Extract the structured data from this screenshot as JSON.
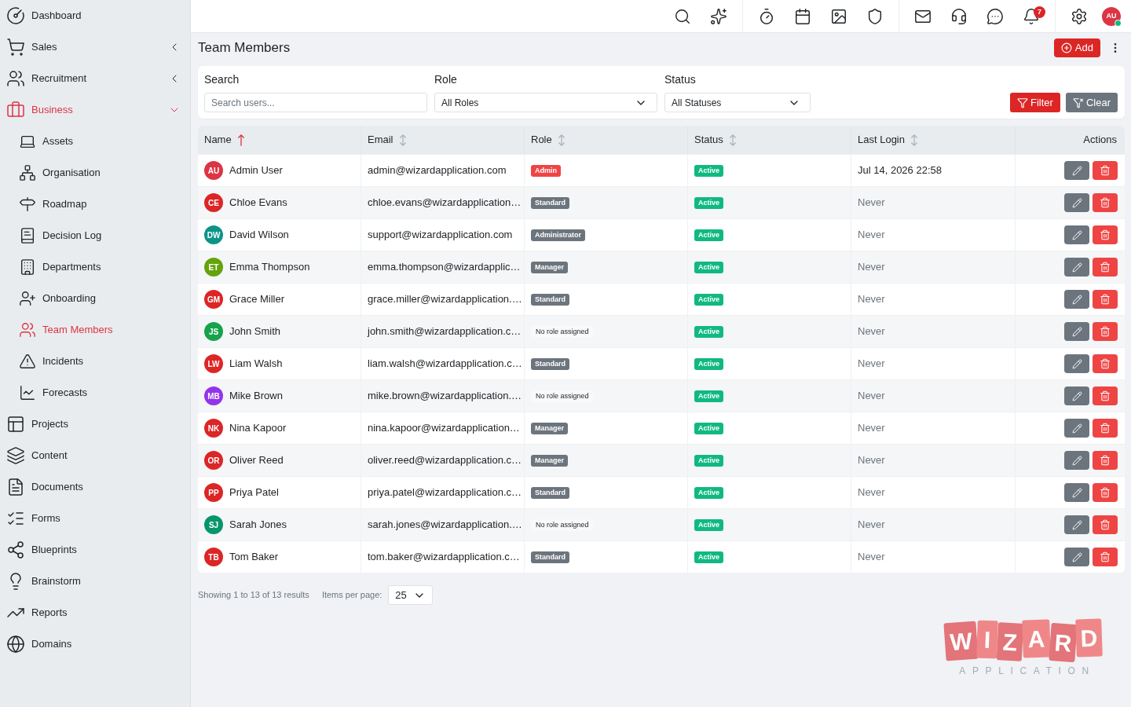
{
  "sidebar": {
    "items": [
      {
        "label": "Dashboard",
        "selected": false
      },
      {
        "label": "Sales",
        "selected": false,
        "expanded": false
      },
      {
        "label": "Recruitment",
        "selected": false,
        "expanded": false
      },
      {
        "label": "Business",
        "selected": true,
        "expanded": true,
        "children": [
          {
            "label": "Assets",
            "selected": false
          },
          {
            "label": "Organisation",
            "selected": false
          },
          {
            "label": "Roadmap",
            "selected": false
          },
          {
            "label": "Decision Log",
            "selected": false
          },
          {
            "label": "Departments",
            "selected": false
          },
          {
            "label": "Onboarding",
            "selected": false
          },
          {
            "label": "Team Members",
            "selected": true
          },
          {
            "label": "Incidents",
            "selected": false
          },
          {
            "label": "Forecasts",
            "selected": false
          }
        ]
      },
      {
        "label": "Projects",
        "selected": false
      },
      {
        "label": "Content",
        "selected": false
      },
      {
        "label": "Documents",
        "selected": false
      },
      {
        "label": "Forms",
        "selected": false
      },
      {
        "label": "Blueprints",
        "selected": false
      },
      {
        "label": "Brainstorm",
        "selected": false
      },
      {
        "label": "Reports",
        "selected": false
      },
      {
        "label": "Domains",
        "selected": false
      }
    ]
  },
  "topbar": {
    "notification_count": "7",
    "user": {
      "initials": "AU",
      "online": true
    }
  },
  "page": {
    "title": "Team Members",
    "add_button": "Add"
  },
  "filters": {
    "search": {
      "label": "Search",
      "placeholder": "Search users..."
    },
    "role": {
      "label": "Role",
      "value": "All Roles"
    },
    "status": {
      "label": "Status",
      "value": "All Statuses"
    },
    "buttons": [
      {
        "label": "Filter",
        "kind": "primary"
      },
      {
        "label": "Clear",
        "kind": "secondary"
      }
    ]
  },
  "table": {
    "columns": [
      {
        "label": "Name",
        "sorted": true
      },
      {
        "label": "Email",
        "sorted": false
      },
      {
        "label": "Role",
        "sorted": false
      },
      {
        "label": "Status",
        "sorted": false
      },
      {
        "label": "Last Login",
        "sorted": false
      },
      {
        "label": "Actions"
      }
    ],
    "rows": [
      {
        "initials": "AU",
        "color": "#dc3545",
        "name": "Admin User",
        "email": "admin@wizardapplication.com",
        "role": {
          "label": "Admin",
          "kind": "admin"
        },
        "status": "Active",
        "last_login": {
          "text": "Jul 14, 2026 22:58",
          "muted": false
        }
      },
      {
        "initials": "CE",
        "color": "#dc2626",
        "name": "Chloe Evans",
        "email": "chloe.evans@wizardapplication…",
        "role": {
          "label": "Standard",
          "kind": "assigned"
        },
        "status": "Active",
        "last_login": {
          "text": "Never",
          "muted": true
        }
      },
      {
        "initials": "DW",
        "color": "#0d9488",
        "name": "David Wilson",
        "email": "support@wizardapplication.com",
        "role": {
          "label": "Administrator",
          "kind": "assigned"
        },
        "status": "Active",
        "last_login": {
          "text": "Never",
          "muted": true
        }
      },
      {
        "initials": "ET",
        "color": "#65a30d",
        "name": "Emma Thompson",
        "email": "emma.thompson@wizardapplic…",
        "role": {
          "label": "Manager",
          "kind": "assigned"
        },
        "status": "Active",
        "last_login": {
          "text": "Never",
          "muted": true
        }
      },
      {
        "initials": "GM",
        "color": "#dc2626",
        "name": "Grace Miller",
        "email": "grace.miller@wizardapplication.…",
        "role": {
          "label": "Standard",
          "kind": "assigned"
        },
        "status": "Active",
        "last_login": {
          "text": "Never",
          "muted": true
        }
      },
      {
        "initials": "JS",
        "color": "#16a34a",
        "name": "John Smith",
        "email": "john.smith@wizardapplication.c…",
        "role": {
          "label": "No role assigned",
          "kind": "unassigned"
        },
        "status": "Active",
        "last_login": {
          "text": "Never",
          "muted": true
        }
      },
      {
        "initials": "LW",
        "color": "#dc2626",
        "name": "Liam Walsh",
        "email": "liam.walsh@wizardapplication.c…",
        "role": {
          "label": "Standard",
          "kind": "assigned"
        },
        "status": "Active",
        "last_login": {
          "text": "Never",
          "muted": true
        }
      },
      {
        "initials": "MB",
        "color": "#9333ea",
        "name": "Mike Brown",
        "email": "mike.brown@wizardapplication.…",
        "role": {
          "label": "No role assigned",
          "kind": "unassigned"
        },
        "status": "Active",
        "last_login": {
          "text": "Never",
          "muted": true
        }
      },
      {
        "initials": "NK",
        "color": "#dc2626",
        "name": "Nina Kapoor",
        "email": "nina.kapoor@wizardapplication…",
        "role": {
          "label": "Manager",
          "kind": "assigned"
        },
        "status": "Active",
        "last_login": {
          "text": "Never",
          "muted": true
        }
      },
      {
        "initials": "OR",
        "color": "#dc2626",
        "name": "Oliver Reed",
        "email": "oliver.reed@wizardapplication.c…",
        "role": {
          "label": "Manager",
          "kind": "assigned"
        },
        "status": "Active",
        "last_login": {
          "text": "Never",
          "muted": true
        }
      },
      {
        "initials": "PP",
        "color": "#dc2626",
        "name": "Priya Patel",
        "email": "priya.patel@wizardapplication.c…",
        "role": {
          "label": "Standard",
          "kind": "assigned"
        },
        "status": "Active",
        "last_login": {
          "text": "Never",
          "muted": true
        }
      },
      {
        "initials": "SJ",
        "color": "#059669",
        "name": "Sarah Jones",
        "email": "sarah.jones@wizardapplication.…",
        "role": {
          "label": "No role assigned",
          "kind": "unassigned"
        },
        "status": "Active",
        "last_login": {
          "text": "Never",
          "muted": true
        }
      },
      {
        "initials": "TB",
        "color": "#dc2626",
        "name": "Tom Baker",
        "email": "tom.baker@wizardapplication.c…",
        "role": {
          "label": "Standard",
          "kind": "assigned"
        },
        "status": "Active",
        "last_login": {
          "text": "Never",
          "muted": true
        }
      }
    ]
  },
  "pagination": {
    "summary": "Showing 1 to 13 of 13 results",
    "per_page_label": "Items per page:",
    "per_page": "25"
  },
  "brand": {
    "letters": [
      "W",
      "I",
      "Z",
      "A",
      "R",
      "D"
    ],
    "tagline": "APPLICATION"
  }
}
